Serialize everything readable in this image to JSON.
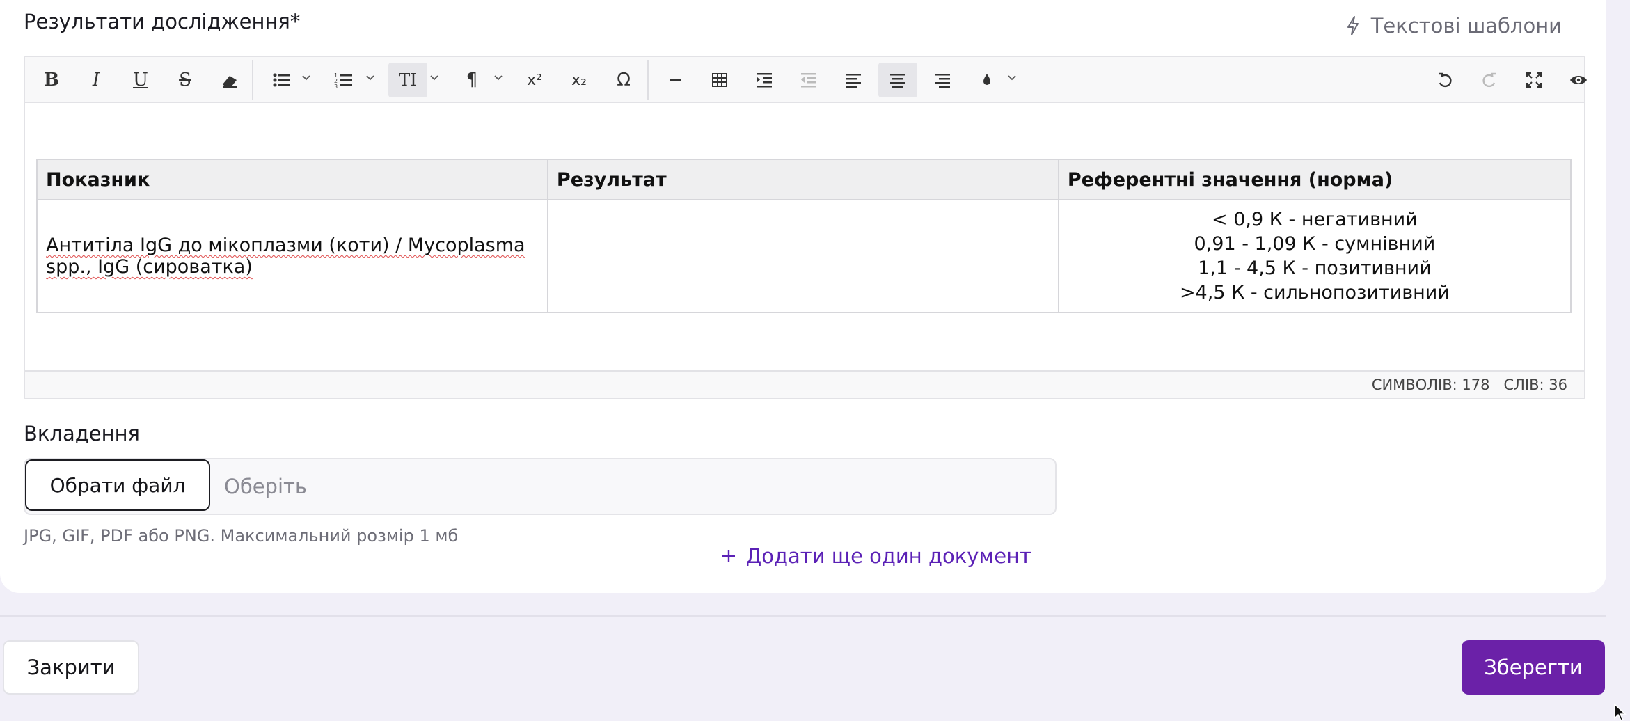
{
  "results": {
    "label": "Результати дослідження*",
    "templates_label": "Текстові шаблони"
  },
  "table": {
    "headers": [
      "Показник",
      "Результат",
      "Референтні значення (норма)"
    ],
    "row": {
      "indicator": "Антитіла IgG до мікоплазми (коти) / Mycoplasma spp., IgG (сироватка)",
      "result": "",
      "reference": [
        "< 0,9 К - негативний",
        "0,91 - 1,09 К - сумнівний",
        "1,1 - 4,5 К - позитивний",
        ">4,5 К - сильнопозитивний"
      ]
    }
  },
  "status": {
    "chars": "СИМВОЛІВ: 178",
    "words": "СЛІВ: 36"
  },
  "attachments": {
    "label": "Вкладення",
    "choose_button": "Обрати файл",
    "placeholder": "Оберіть",
    "hint": "JPG, GIF, PDF або PNG. Максимальний розмір 1 мб",
    "add_document": "Додати ще один документ"
  },
  "footer": {
    "close": "Закрити",
    "save": "Зберегти"
  },
  "colors": {
    "accent": "#6b21a8",
    "link": "#5b21b6",
    "background": "#f1eff8"
  }
}
